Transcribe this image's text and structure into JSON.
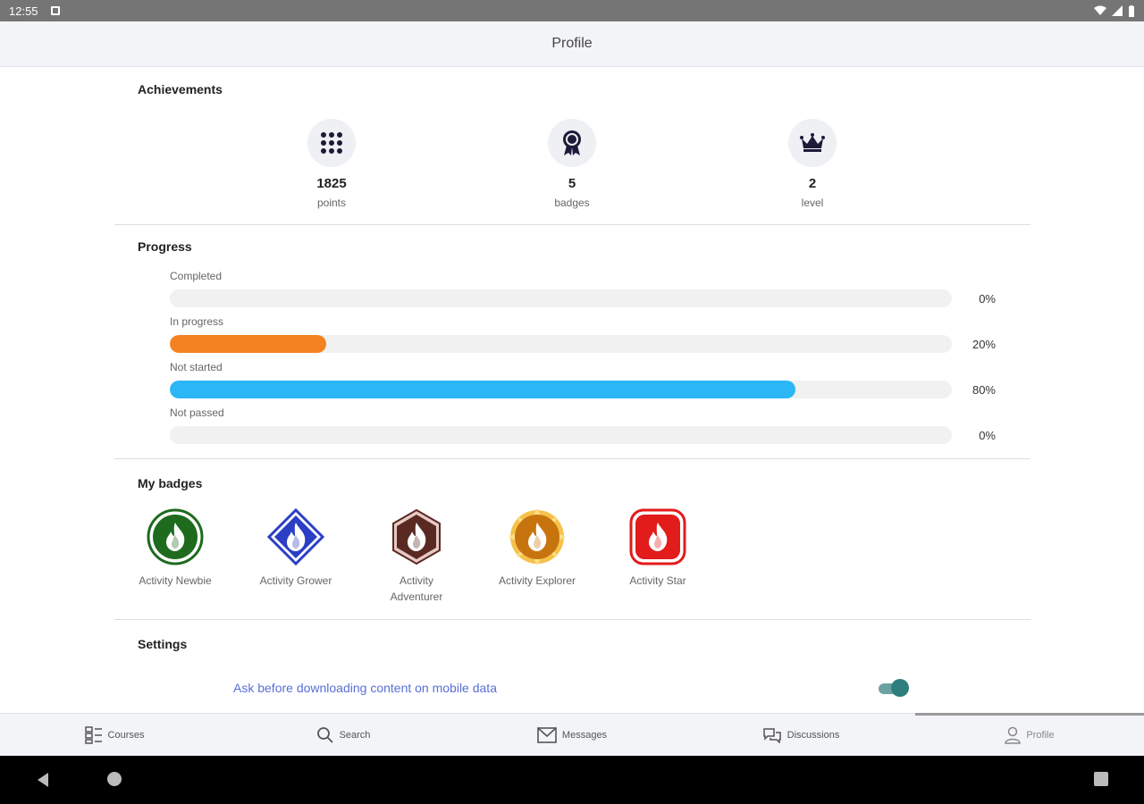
{
  "status_bar": {
    "time": "12:55"
  },
  "header": {
    "title": "Profile"
  },
  "achievements": {
    "title": "Achievements",
    "items": [
      {
        "icon": "grid-icon",
        "value": "1825",
        "label": "points"
      },
      {
        "icon": "ribbon-award-icon",
        "value": "5",
        "label": "badges"
      },
      {
        "icon": "crown-icon",
        "value": "2",
        "label": "level"
      }
    ]
  },
  "progress": {
    "title": "Progress",
    "rows": [
      {
        "label": "Completed",
        "percent": 0,
        "percent_text": "0%",
        "color": "#f08021"
      },
      {
        "label": "In progress",
        "percent": 20,
        "percent_text": "20%",
        "color": "#f58220"
      },
      {
        "label": "Not started",
        "percent": 80,
        "percent_text": "80%",
        "color": "#2bb6f6"
      },
      {
        "label": "Not passed",
        "percent": 0,
        "percent_text": "0%",
        "color": "#e04040"
      }
    ]
  },
  "badges": {
    "title": "My badges",
    "items": [
      {
        "label": "Activity Newbie",
        "color": "#1e6b1e",
        "shape": "circle"
      },
      {
        "label": "Activity Grower",
        "color": "#2b3fc4",
        "shape": "diamond"
      },
      {
        "label": "Activity Adventurer",
        "color": "#5a2a22",
        "shape": "hexagon"
      },
      {
        "label": "Activity Explorer",
        "color": "#c8740e",
        "shape": "sun"
      },
      {
        "label": "Activity Star",
        "color": "#e21b1b",
        "shape": "rounded-square"
      }
    ]
  },
  "settings": {
    "title": "Settings",
    "mobile_data_label": "Ask before downloading content on mobile data",
    "mobile_data_enabled": true
  },
  "bottom_nav": [
    {
      "label": "Courses",
      "icon": "courses-icon"
    },
    {
      "label": "Search",
      "icon": "search-icon"
    },
    {
      "label": "Messages",
      "icon": "mail-icon"
    },
    {
      "label": "Discussions",
      "icon": "chat-icon"
    },
    {
      "label": "Profile",
      "icon": "person-icon",
      "active": true
    }
  ]
}
